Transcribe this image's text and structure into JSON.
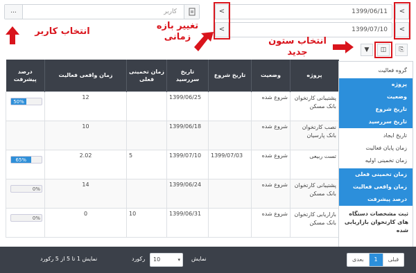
{
  "user_filter": {
    "placeholder": "کاربر",
    "more_label": "...",
    "doc_icon": "document-icon"
  },
  "date_range": {
    "from": "1399/06/11",
    "to": "1399/07/10",
    "prev": "<",
    "next": "<"
  },
  "annotations": {
    "select_user": "انتخاب کاربر",
    "change_range": "تغییر بازه زمانی",
    "select_column": "انتخاب ستون جدید"
  },
  "toolbar": {
    "filter_icon": "▼",
    "columns_icon": "◫",
    "export_icon": "⎘"
  },
  "table": {
    "headers": {
      "project": "پروژه",
      "status": "وضعیت",
      "start_date": "تاریخ شروع",
      "due_date": "تاریخ سررسید",
      "est_time": "زمان تخمینی فعلی",
      "actual_time": "زمان واقعی فعالیت",
      "progress": "درصد پیشرفت"
    },
    "rows": [
      {
        "project": "پشتیبانی کارتخوان بانک مسکن",
        "status": "شروع شده",
        "start_date": "",
        "due_date": "1399/06/25",
        "est_time": "",
        "actual_time": "12",
        "progress": "50%",
        "progress_value": 50
      },
      {
        "project": "نصب کارتخوان بانک پارسیان",
        "status": "شروع شده",
        "start_date": "",
        "due_date": "1399/06/18",
        "est_time": "",
        "actual_time": "10",
        "progress": "",
        "progress_value": 0
      },
      {
        "project": "تست ربیعی",
        "status": "شروع شده",
        "start_date": "1399/07/03",
        "due_date": "1399/07/10",
        "est_time": "5",
        "actual_time": "2.02",
        "progress": "65%",
        "progress_value": 65
      },
      {
        "project": "پشتیبانی کارتخوان بانک مسکن",
        "status": "شروع شده",
        "start_date": "",
        "due_date": "1399/06/24",
        "est_time": "",
        "actual_time": "14",
        "progress": "0%",
        "progress_value": 0
      },
      {
        "project": "بازاریابی کارتخوان بانک مسکن",
        "status": "شروع شده",
        "start_date": "",
        "due_date": "1399/06/31",
        "est_time": "10",
        "actual_time": "0",
        "progress": "0%",
        "progress_value": 0
      }
    ]
  },
  "column_menu": {
    "items": [
      {
        "label": "گروه فعالیت",
        "selected": false
      },
      {
        "label": "پروژه",
        "selected": true
      },
      {
        "label": "وضعیت",
        "selected": true
      },
      {
        "label": "تاریخ شروع",
        "selected": true
      },
      {
        "label": "تاریخ سررسید",
        "selected": true
      },
      {
        "label": "تاریخ ایجاد",
        "selected": false
      },
      {
        "label": "زمان پایان فعالیت",
        "selected": false
      },
      {
        "label": "زمان تخمینی اولیه",
        "selected": false
      },
      {
        "label": "زمان تخمینی فعلی",
        "selected": true
      },
      {
        "label": "زمان واقعی فعالیت",
        "selected": true
      },
      {
        "label": "درصد پیشرفت",
        "selected": true
      }
    ],
    "note": "ثبت مشخصات دستگاه های کارتخوان بازاریابی شده"
  },
  "footer": {
    "prev": "قبلی",
    "page": "1",
    "next": "بعدی",
    "show_label": "نمایش",
    "page_size": "10",
    "records_label": "رکورد",
    "summary": "نمایش 1 تا 5 از 5 رکورد"
  }
}
